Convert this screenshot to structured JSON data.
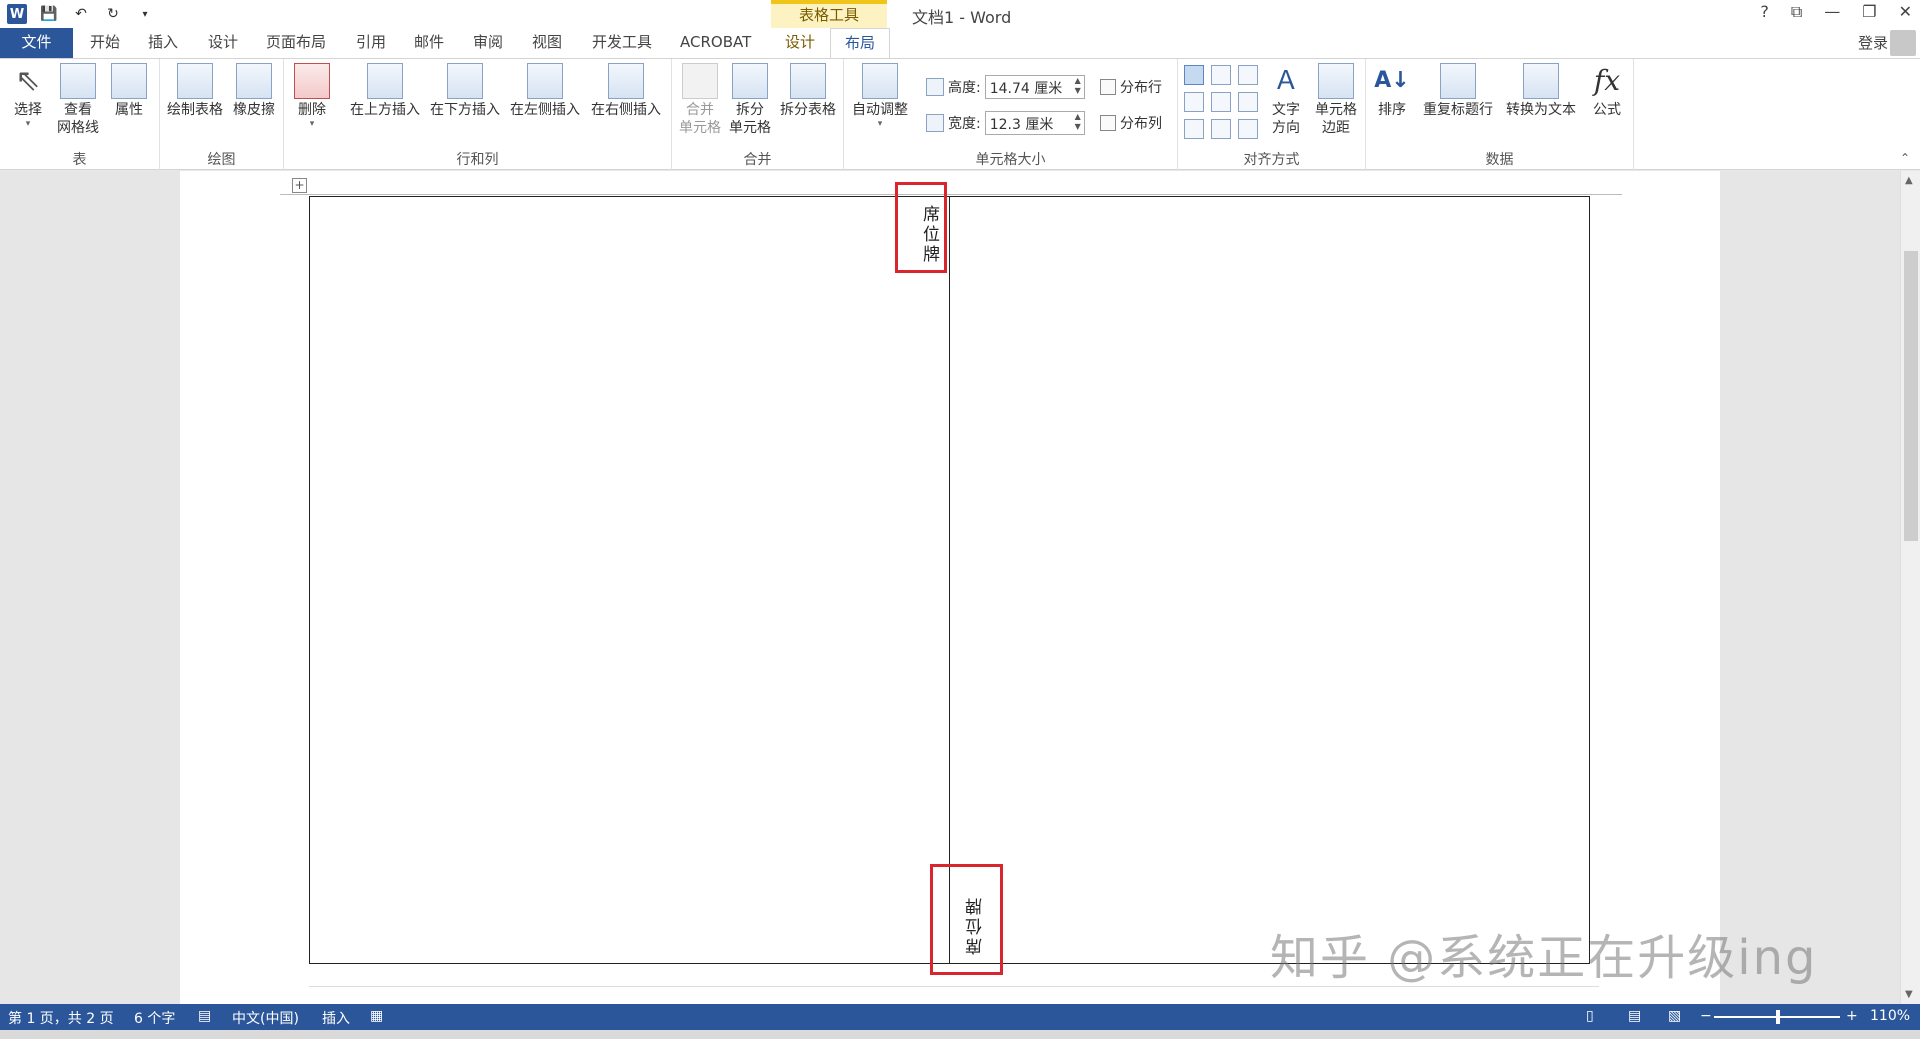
{
  "window": {
    "doc_title": "文档1 - Word",
    "table_tools": "表格工具",
    "controls": [
      "?",
      "⧉",
      "—",
      "❐",
      "✕"
    ],
    "login": "登录"
  },
  "tabs": [
    {
      "label": "文件",
      "x": 0
    },
    {
      "label": "开始"
    },
    {
      "label": "插入"
    },
    {
      "label": "设计"
    },
    {
      "label": "页面布局"
    },
    {
      "label": "引用"
    },
    {
      "label": "邮件"
    },
    {
      "label": "审阅"
    },
    {
      "label": "视图"
    },
    {
      "label": "开发工具"
    },
    {
      "label": "ACROBAT"
    },
    {
      "label": "设计"
    },
    {
      "label": "布局"
    }
  ],
  "ribbon": {
    "groups": {
      "table": "表",
      "draw": "绘图",
      "rows_cols": "行和列",
      "merge": "合并",
      "cell_size": "单元格大小",
      "align": "对齐方式",
      "data": "数据"
    },
    "buttons": {
      "select": "选择",
      "view_gridlines_1": "查看",
      "view_gridlines_2": "网格线",
      "properties": "属性",
      "draw_table": "绘制表格",
      "eraser": "橡皮擦",
      "delete": "删除",
      "insert_above": "在上方插入",
      "insert_below": "在下方插入",
      "insert_left": "在左侧插入",
      "insert_right": "在右侧插入",
      "merge_1": "合并",
      "merge_2": "单元格",
      "split_1": "拆分",
      "split_2": "单元格",
      "split_table": "拆分表格",
      "autofit": "自动调整",
      "text_dir_1": "文字",
      "text_dir_2": "方向",
      "cell_margin_1": "单元格",
      "cell_margin_2": "边距",
      "sort": "排序",
      "repeat_header": "重复标题行",
      "convert_text": "转换为文本",
      "formula": "公式"
    },
    "cell_size": {
      "height_label": "高度:",
      "height_value": "14.74 厘米",
      "width_label": "宽度:",
      "width_value": "12.3 厘米",
      "distribute_rows": "分布行",
      "distribute_cols": "分布列"
    }
  },
  "document": {
    "cell_text_top": "席位牌",
    "cell_text_bottom": "席位牌",
    "watermark": "知乎 @系统正在升级ing"
  },
  "status": {
    "page": "第 1 页，共 2 页",
    "words": "6 个字",
    "lang": "中文(中国)",
    "mode": "插入",
    "zoom": "110%"
  }
}
